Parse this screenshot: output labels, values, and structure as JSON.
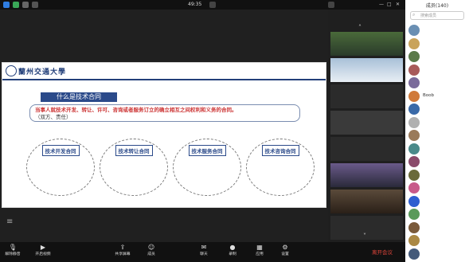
{
  "window": {
    "elapsed_time": "49:35",
    "view_label": "",
    "status_label": ""
  },
  "stage": {
    "sharer_label": "",
    "slide": {
      "university_name": "蘭州交通大學",
      "title": "什么是技术合同",
      "definition_prefix": "",
      "definition_red_1": "当事人就技术开发、转让、许可、咨询或者服务订立的确立相互之间权利和义务的合同。",
      "definition_suffix": "（双方、责任）",
      "cards": [
        {
          "title": "技术开发合同",
          "body": ""
        },
        {
          "title": "技术转让合同",
          "body": ""
        },
        {
          "title": "技术服务合同",
          "body": ""
        },
        {
          "title": "技术咨询合同",
          "body": ""
        }
      ],
      "footer": ""
    }
  },
  "tiles": [
    {
      "caption": ""
    },
    {
      "caption": ""
    },
    {
      "caption": ""
    },
    {
      "caption": ""
    },
    {
      "caption": ""
    },
    {
      "caption": ""
    },
    {
      "caption": ""
    },
    {
      "caption": ""
    }
  ],
  "participants_panel": {
    "title": "成员(140)",
    "search_placeholder": "搜索成员",
    "members": [
      {
        "name": "",
        "avatar_color": "#6a8fb3"
      },
      {
        "name": "",
        "avatar_color": "#c9a35a"
      },
      {
        "name": "",
        "avatar_color": "#5a7a4a"
      },
      {
        "name": "",
        "avatar_color": "#a85a5a"
      },
      {
        "name": "",
        "avatar_color": "#7a6a9a"
      },
      {
        "name": "Boob",
        "avatar_color": "#d07a3a"
      },
      {
        "name": "",
        "avatar_color": "#3a6aa8"
      },
      {
        "name": "",
        "avatar_color": "#b0b0b0"
      },
      {
        "name": "",
        "avatar_color": "#9a7a5a"
      },
      {
        "name": "",
        "avatar_color": "#4a8a8a"
      },
      {
        "name": "",
        "avatar_color": "#8a4a6a"
      },
      {
        "name": "",
        "avatar_color": "#6a6a3a"
      },
      {
        "name": "",
        "avatar_color": "#c85a8a"
      },
      {
        "name": "",
        "avatar_color": "#2f5fd0"
      },
      {
        "name": "",
        "avatar_color": "#5a9a5a"
      },
      {
        "name": "",
        "avatar_color": "#7a5a3a"
      },
      {
        "name": "",
        "avatar_color": "#aa8844"
      },
      {
        "name": "",
        "avatar_color": "#445a7a"
      }
    ]
  },
  "toolbar": {
    "buttons": [
      {
        "label": "解除静音",
        "icon": "mic-icon"
      },
      {
        "label": "开启视频",
        "icon": "video-icon"
      },
      {
        "label": "共享屏幕",
        "icon": "share-icon"
      },
      {
        "label": "成员",
        "icon": "members-icon"
      },
      {
        "label": "聊天",
        "icon": "chat-icon"
      },
      {
        "label": "录制",
        "icon": "record-icon"
      },
      {
        "label": "应用",
        "icon": "apps-icon"
      },
      {
        "label": "设置",
        "icon": "settings-icon"
      }
    ],
    "leave_label": "离开会议"
  }
}
